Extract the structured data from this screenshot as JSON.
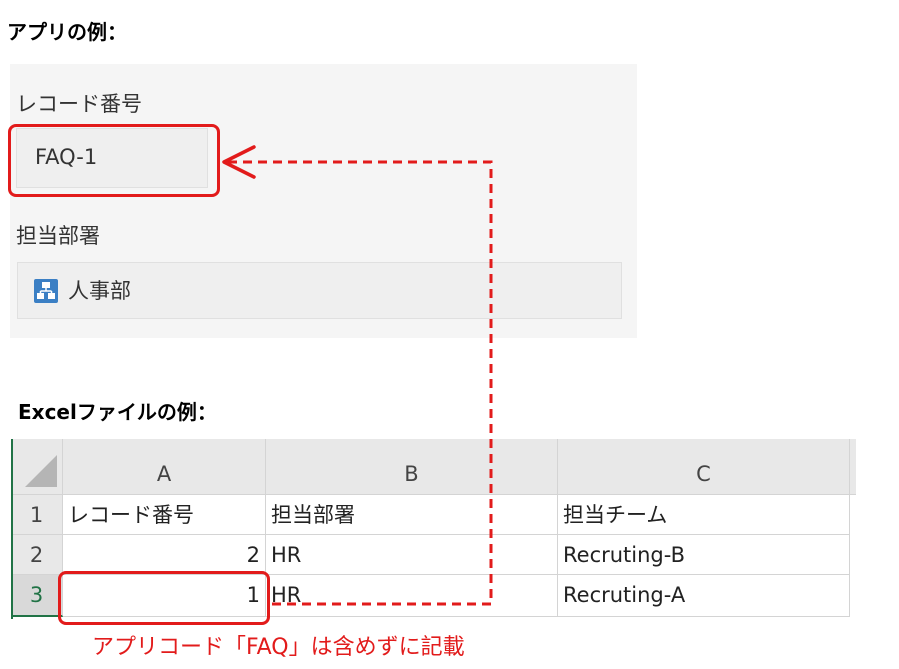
{
  "headings": {
    "app": "アプリの例：",
    "excel": "Excelファイルの例："
  },
  "app_form": {
    "record_label": "レコード番号",
    "record_value": "FAQ-1",
    "dept_label": "担当部署",
    "dept_value": "人事部",
    "dept_icon": "organization-icon"
  },
  "excel": {
    "column_headers": [
      "A",
      "B",
      "C"
    ],
    "rows": [
      {
        "row_number": "1",
        "cells": [
          "レコード番号",
          "担当部署",
          "担当チーム"
        ]
      },
      {
        "row_number": "2",
        "cells": [
          "2",
          "HR",
          "Recruting-B"
        ]
      },
      {
        "row_number": "3",
        "cells": [
          "1",
          "HR",
          "Recruting-A"
        ]
      }
    ]
  },
  "annotation": {
    "note": "アプリコード「FAQ」は含めずに記載",
    "color": "#e21b1b"
  }
}
